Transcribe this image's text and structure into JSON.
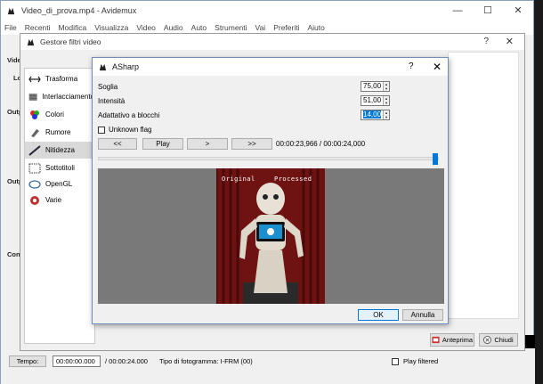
{
  "main": {
    "title": "Video_di_prova.mp4 - Avidemux",
    "window_controls": [
      "—",
      "☐",
      "✕"
    ],
    "menu": [
      "File",
      "Recenti",
      "Modifica",
      "Visualizza",
      "Video",
      "Audio",
      "Auto",
      "Strumenti",
      "Vai",
      "Preferiti",
      "Aiuto"
    ],
    "left_labels": [
      "Vide",
      "Lo",
      "Outp",
      "Outp",
      "Con"
    ]
  },
  "filter_manager": {
    "title": "Gestore filtri video",
    "help": "?",
    "close": "✕",
    "categories": [
      {
        "label": "Trasforma",
        "icon": "transform-icon"
      },
      {
        "label": "Interlacciamento",
        "icon": "interlace-icon"
      },
      {
        "label": "Colori",
        "icon": "colors-icon"
      },
      {
        "label": "Rumore",
        "icon": "noise-icon"
      },
      {
        "label": "Nitidezza",
        "icon": "sharpness-icon",
        "selected": true
      },
      {
        "label": "Sottotitoli",
        "icon": "subtitles-icon"
      },
      {
        "label": "OpenGL",
        "icon": "opengl-icon"
      },
      {
        "label": "Varie",
        "icon": "misc-icon"
      }
    ],
    "preview_button": "Anteprima",
    "close_button": "Chiudi"
  },
  "asharp": {
    "title": "ASharp",
    "help": "?",
    "close": "✕",
    "params": [
      {
        "label": "Soglia",
        "value": "75,00"
      },
      {
        "label": "Intensità",
        "value": "51,00"
      },
      {
        "label": "Adattativo a blocchi",
        "value": "14,00",
        "selected": true
      }
    ],
    "unknown_flag": "Unknown flag",
    "nav": [
      "<<",
      "Play",
      ">",
      ">>"
    ],
    "time": "00:00:23,966 / 00:00:24,000",
    "slider_position": 0.998,
    "preview_labels": {
      "original": "Original",
      "processed": "Processed"
    },
    "ok": "OK",
    "cancel": "Annulla"
  },
  "status": {
    "tempo_label": "Tempo:",
    "current_time": "00:00:00.000",
    "duration": "/ 00:00:24.000",
    "frame_type": "Tipo di fotogramma:  I-FRM (00)",
    "play_filtered": "Play filtered"
  },
  "colors": {
    "accent": "#0078d7",
    "preview_bg": "#797979",
    "curtain": "#6e1212"
  }
}
